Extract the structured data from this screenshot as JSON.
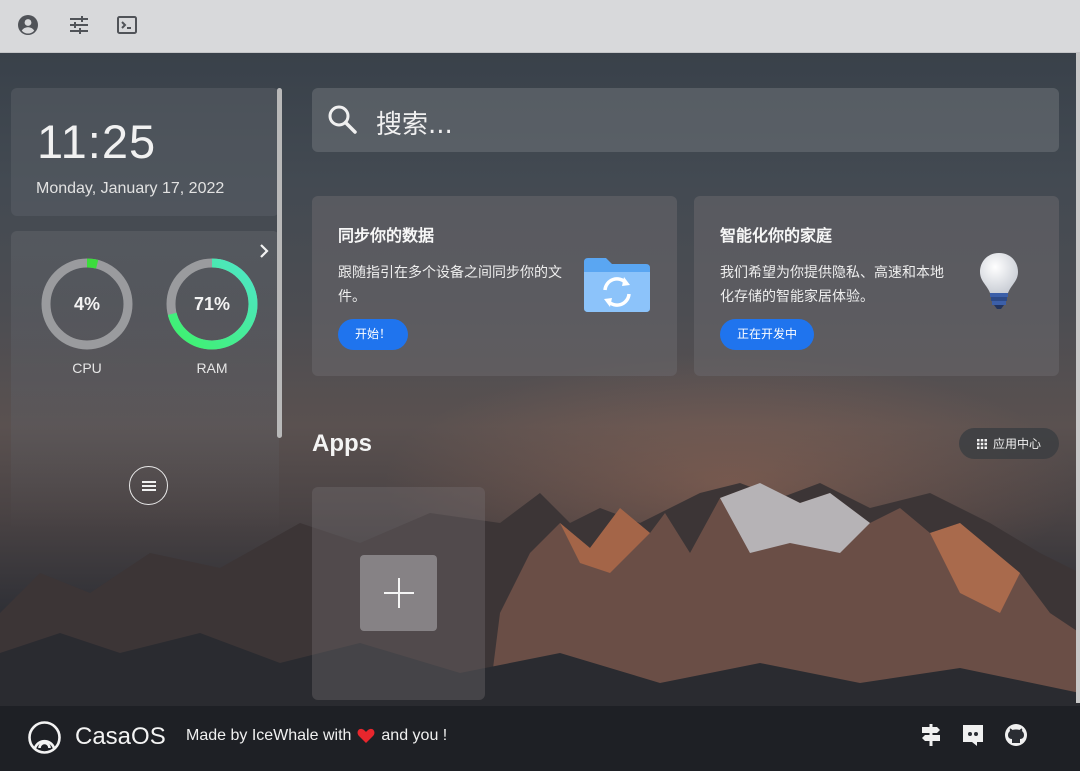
{
  "clock": {
    "time": "11:25",
    "date": "Monday, January 17, 2022"
  },
  "stats": {
    "cpu": {
      "label": "CPU",
      "value": "4%",
      "percent": 4,
      "color": "#3cdc3c"
    },
    "ram": {
      "label": "RAM",
      "value": "71%",
      "percent": 71,
      "color": "#4ef2a0"
    }
  },
  "search": {
    "placeholder": "搜索..."
  },
  "cards": [
    {
      "title": "同步你的数据",
      "desc": "跟随指引在多个设备之间同步你的文件。",
      "button": "开始！",
      "icon": "sync-folder-icon"
    },
    {
      "title": "智能化你的家庭",
      "desc": "我们希望为你提供隐私、高速和本地化存储的智能家居体验。",
      "button": "正在开发中",
      "icon": "light-bulb-icon"
    }
  ],
  "apps": {
    "title": "Apps",
    "store_button": "应用中心"
  },
  "footer": {
    "brand": "CasaOS",
    "made_by_prefix": "Made by IceWhale with",
    "made_by_suffix": "and you !"
  },
  "colors": {
    "accent": "#1f74ee",
    "topbar": "#d8d9db"
  }
}
